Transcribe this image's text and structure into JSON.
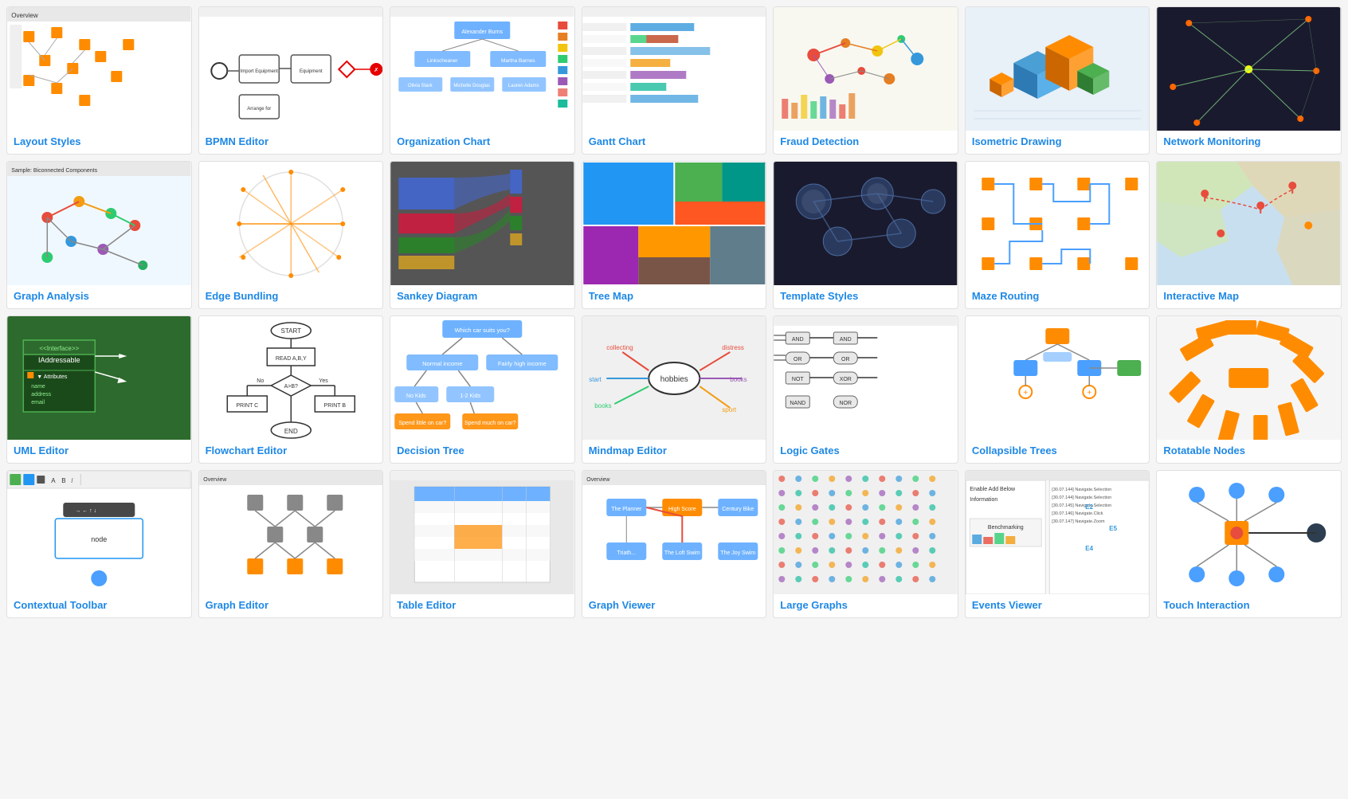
{
  "cards": [
    {
      "id": "layout-styles",
      "label": "Layout Styles",
      "preview_type": "layout"
    },
    {
      "id": "bpmn-editor",
      "label": "BPMN Editor",
      "preview_type": "bpmn"
    },
    {
      "id": "organization-chart",
      "label": "Organization Chart",
      "preview_type": "org"
    },
    {
      "id": "gantt-chart",
      "label": "Gantt Chart",
      "preview_type": "gantt"
    },
    {
      "id": "fraud-detection",
      "label": "Fraud Detection",
      "preview_type": "fraud"
    },
    {
      "id": "isometric-drawing",
      "label": "Isometric Drawing",
      "preview_type": "isometric"
    },
    {
      "id": "network-monitoring",
      "label": "Network Monitoring",
      "preview_type": "network"
    },
    {
      "id": "graph-analysis",
      "label": "Graph Analysis",
      "preview_type": "graph-analysis"
    },
    {
      "id": "edge-bundling",
      "label": "Edge Bundling",
      "preview_type": "edge-bundling"
    },
    {
      "id": "sankey-diagram",
      "label": "Sankey Diagram",
      "preview_type": "sankey"
    },
    {
      "id": "tree-map",
      "label": "Tree Map",
      "preview_type": "treemap"
    },
    {
      "id": "template-styles",
      "label": "Template Styles",
      "preview_type": "template"
    },
    {
      "id": "maze-routing",
      "label": "Maze Routing",
      "preview_type": "maze"
    },
    {
      "id": "interactive-map",
      "label": "Interactive Map",
      "preview_type": "interactive-map"
    },
    {
      "id": "uml-editor",
      "label": "UML Editor",
      "preview_type": "uml"
    },
    {
      "id": "flowchart-editor",
      "label": "Flowchart Editor",
      "preview_type": "flowchart"
    },
    {
      "id": "decision-tree",
      "label": "Decision Tree",
      "preview_type": "decision-tree"
    },
    {
      "id": "mindmap-editor",
      "label": "Mindmap Editor",
      "preview_type": "mindmap"
    },
    {
      "id": "logic-gates",
      "label": "Logic Gates",
      "preview_type": "logic-gates"
    },
    {
      "id": "collapsible-trees",
      "label": "Collapsible Trees",
      "preview_type": "collapsible"
    },
    {
      "id": "rotatable-nodes",
      "label": "Rotatable Nodes",
      "preview_type": "rotatable"
    },
    {
      "id": "contextual-toolbar",
      "label": "Contextual Toolbar",
      "preview_type": "contextual"
    },
    {
      "id": "graph-editor",
      "label": "Graph Editor",
      "preview_type": "graph-editor"
    },
    {
      "id": "table-editor",
      "label": "Table Editor",
      "preview_type": "table-editor"
    },
    {
      "id": "graph-viewer",
      "label": "Graph Viewer",
      "preview_type": "graph-viewer"
    },
    {
      "id": "large-graphs",
      "label": "Large Graphs",
      "preview_type": "large-graphs"
    },
    {
      "id": "events-viewer",
      "label": "Events Viewer",
      "preview_type": "events"
    },
    {
      "id": "touch-interaction",
      "label": "Touch Interaction",
      "preview_type": "touch"
    }
  ]
}
